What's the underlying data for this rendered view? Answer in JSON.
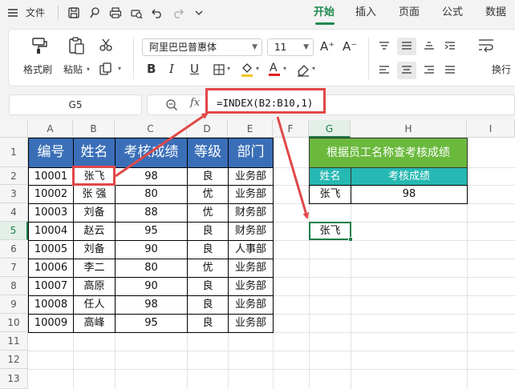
{
  "titlebar": {
    "menu_label": "文件",
    "tabs": [
      {
        "label": "开始",
        "active": true
      },
      {
        "label": "插入",
        "active": false
      },
      {
        "label": "页面",
        "active": false
      },
      {
        "label": "公式",
        "active": false
      },
      {
        "label": "数据",
        "active": false
      }
    ],
    "icons": [
      "menu-icon",
      "save-icon",
      "format-painter-icon",
      "print-icon",
      "print-preview-icon",
      "undo-icon",
      "redo-icon",
      "more-icon"
    ]
  },
  "ribbon": {
    "format_painter": "格式刷",
    "paste": "粘贴",
    "font_name": "阿里巴巴普惠体",
    "font_size": "11",
    "grow_font": "A⁺",
    "shrink_font": "A⁻",
    "bold": "B",
    "italic": "I",
    "underline": "U",
    "wrap": "换行"
  },
  "formula_bar": {
    "cell_ref": "G5",
    "zoom_icon": "zoom-icon",
    "fx": "fx",
    "formula": "=INDEX(B2:B10,1)"
  },
  "columns": [
    "A",
    "B",
    "C",
    "D",
    "E",
    "F",
    "G",
    "H",
    "I"
  ],
  "rows": [
    "1",
    "2",
    "3",
    "4",
    "5",
    "6",
    "7",
    "8",
    "9",
    "10",
    "11",
    "12",
    "13"
  ],
  "table": {
    "headers": [
      "编号",
      "姓名",
      "考核成绩",
      "等级",
      "部门"
    ],
    "rows": [
      [
        "10001",
        "张飞",
        "98",
        "良",
        "业务部"
      ],
      [
        "10002",
        "张 强",
        "80",
        "优",
        "业务部"
      ],
      [
        "10003",
        "刘备",
        "88",
        "优",
        "财务部"
      ],
      [
        "10004",
        "赵云",
        "95",
        "良",
        "财务部"
      ],
      [
        "10005",
        "刘备",
        "90",
        "良",
        "人事部"
      ],
      [
        "10006",
        "李二",
        "80",
        "优",
        "业务部"
      ],
      [
        "10007",
        "高原",
        "90",
        "良",
        "业务部"
      ],
      [
        "10008",
        "任人",
        "98",
        "良",
        "业务部"
      ],
      [
        "10009",
        "高峰",
        "95",
        "良",
        "业务部"
      ]
    ]
  },
  "lookup": {
    "title": "根据员工名称查考核成绩",
    "name_header": "姓名",
    "score_header": "考核成绩",
    "name_value": "张飞",
    "score_value": "98"
  },
  "result_cell": "张飞",
  "colors": {
    "header_blue": "#3a6fb8",
    "title_green": "#6ab93d",
    "teal": "#26b8b2",
    "annotation_red": "#e04848",
    "accent_green": "#1e8a4f"
  }
}
